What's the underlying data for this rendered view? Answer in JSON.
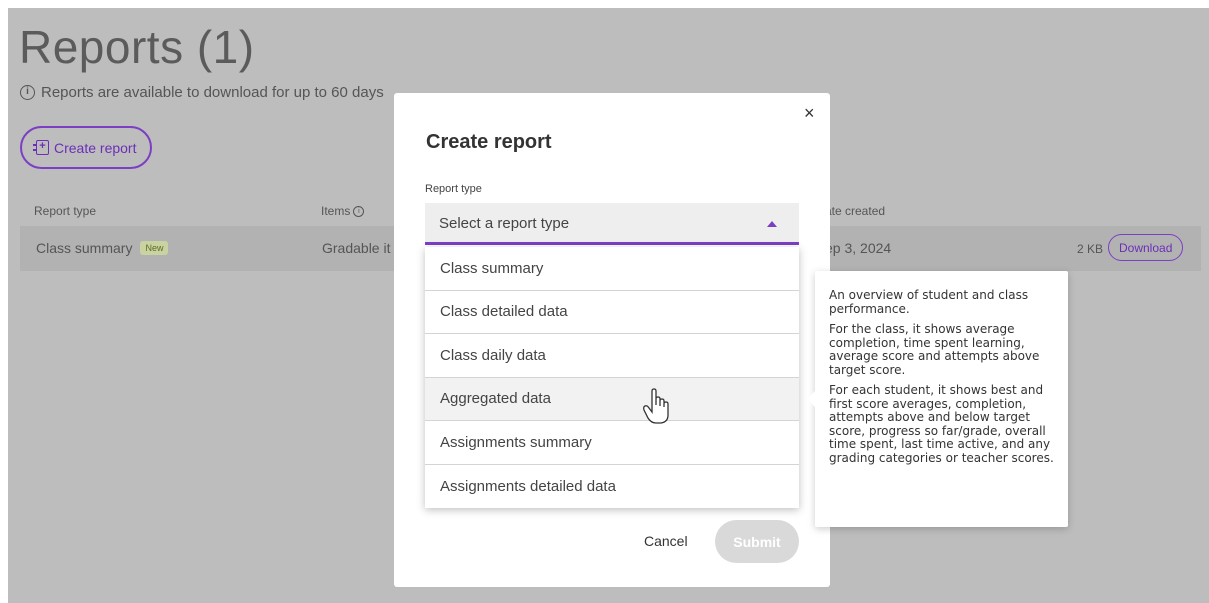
{
  "page": {
    "title": "Reports (1)",
    "availability_note": "Reports are available to download for up to 60 days",
    "create_report_label": "Create report",
    "table": {
      "headers": {
        "type": "Report type",
        "items": "Items",
        "date": "ate created"
      },
      "row": {
        "type": "Class summary",
        "badge": "New",
        "items": "Gradable it",
        "date": "ep 3, 2024",
        "size": "2 KB",
        "download_label": "Download"
      }
    }
  },
  "modal": {
    "close_label": "×",
    "title": "Create report",
    "field_label": "Report type",
    "select_placeholder": "Select a report type",
    "options": [
      "Class summary",
      "Class detailed data",
      "Class daily data",
      "Aggregated data",
      "Assignments summary",
      "Assignments detailed data"
    ],
    "hovered_option": "Aggregated data",
    "cancel_label": "Cancel",
    "submit_label": "Submit"
  },
  "tooltip": {
    "paragraphs": [
      "An overview of student and class performance.",
      "For the class, it shows average completion, time spent learning, average score and attempts above target score.",
      "For each student, it shows best and first score averages, completion, attempts above and below target score, progress so far/grade, overall time spent, last time active, and any grading categories or teacher scores."
    ]
  },
  "colors": {
    "accent": "#7b3fc4",
    "overlay": "#bdbdbd",
    "badge_bg": "#c9d3a2"
  }
}
